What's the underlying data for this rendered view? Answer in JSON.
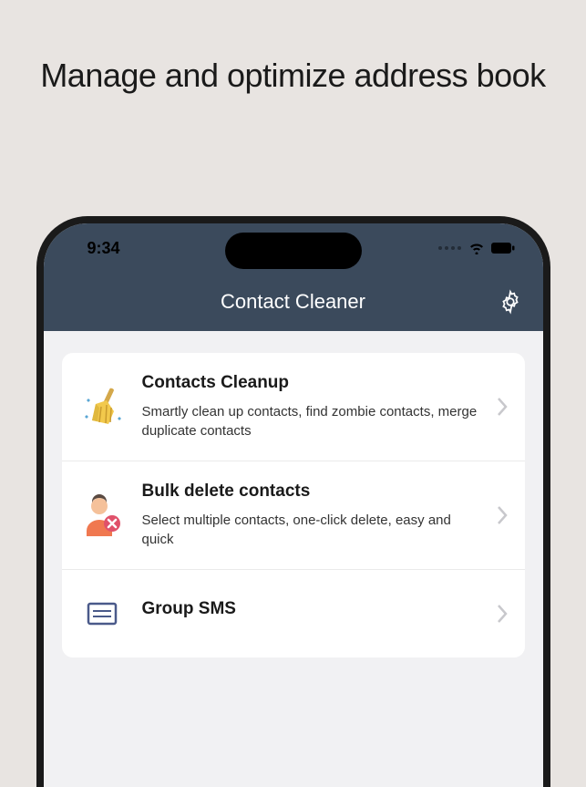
{
  "hero": {
    "title": "Manage and optimize address book"
  },
  "statusBar": {
    "time": "9:34"
  },
  "nav": {
    "title": "Contact Cleaner"
  },
  "features": [
    {
      "title": "Contacts Cleanup",
      "description": "Smartly clean up contacts, find zombie contacts, merge duplicate contacts",
      "icon": "broom"
    },
    {
      "title": "Bulk delete contacts",
      "description": "Select multiple contacts, one-click delete, easy and quick",
      "icon": "person-delete"
    },
    {
      "title": "Group SMS",
      "description": "",
      "icon": "sms"
    }
  ]
}
